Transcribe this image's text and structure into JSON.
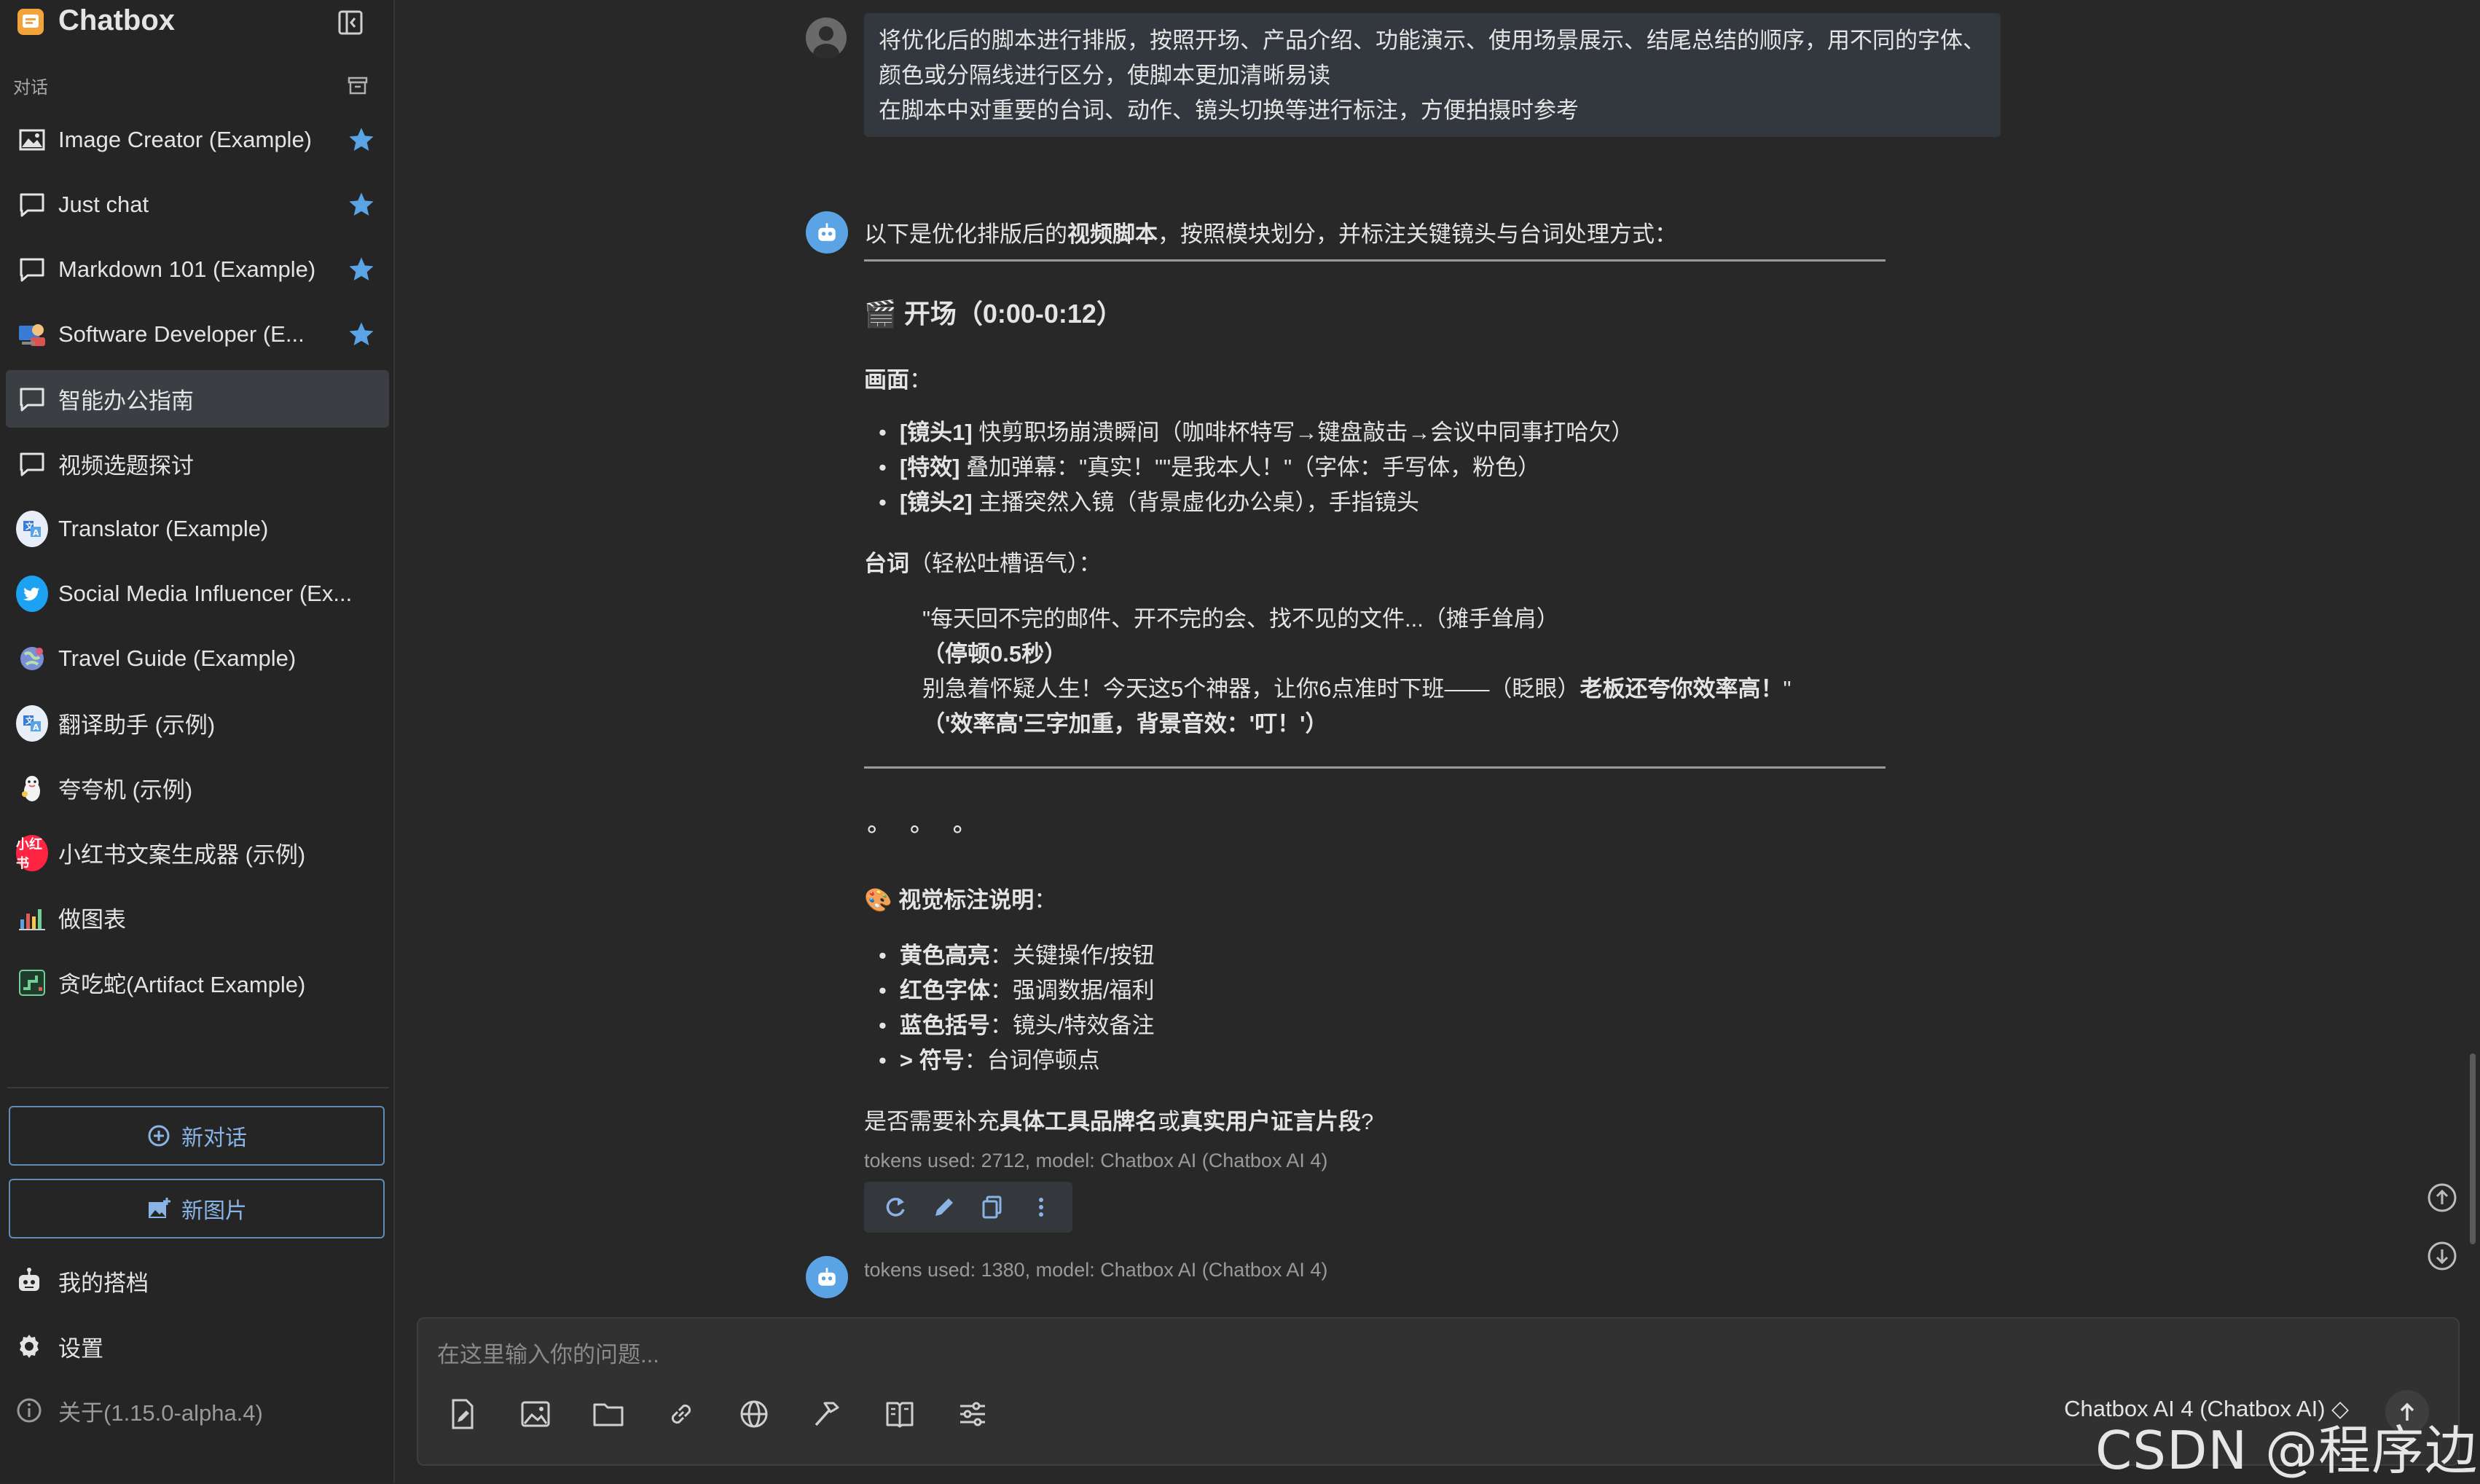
{
  "app": {
    "title": "Chatbox"
  },
  "sidebar": {
    "section_label": "对话",
    "items": [
      {
        "label": "Image Creator (Example)",
        "starred": true,
        "icon": "image-icon"
      },
      {
        "label": "Just chat",
        "starred": true,
        "icon": "chat-bubble-icon"
      },
      {
        "label": "Markdown 101 (Example)",
        "starred": true,
        "icon": "chat-bubble-icon"
      },
      {
        "label": "Software Developer (E...",
        "starred": true,
        "icon": "developer-avatar"
      },
      {
        "label": "智能办公指南",
        "starred": false,
        "active": true,
        "icon": "chat-bubble-icon"
      },
      {
        "label": "视频选题探讨",
        "starred": false,
        "icon": "chat-bubble-icon"
      },
      {
        "label": "Translator (Example)",
        "starred": false,
        "icon": "translator-avatar"
      },
      {
        "label": "Social Media Influencer (Ex...",
        "starred": false,
        "icon": "twitter-avatar"
      },
      {
        "label": "Travel Guide (Example)",
        "starred": false,
        "icon": "globe-avatar"
      },
      {
        "label": "翻译助手 (示例)",
        "starred": false,
        "icon": "translator-avatar"
      },
      {
        "label": "夸夸机 (示例)",
        "starred": false,
        "icon": "cheer-avatar"
      },
      {
        "label": "小红书文案生成器 (示例)",
        "starred": false,
        "icon": "xiaohongshu-avatar",
        "avatar_text": "小红书"
      },
      {
        "label": "做图表",
        "starred": false,
        "icon": "chart-avatar"
      },
      {
        "label": "贪吃蛇(Artifact Example)",
        "starred": false,
        "icon": "snake-avatar"
      }
    ],
    "new_chat": "新对话",
    "new_image": "新图片",
    "my_partners": "我的搭档",
    "settings": "设置",
    "about": "关于(1.15.0-alpha.4)"
  },
  "chat": {
    "user_message": [
      "将优化后的脚本进行排版，按照开场、产品介绍、功能演示、使用场景展示、结尾总结的顺序，用不同的字体、",
      "颜色或分隔线进行区分，使脚本更加清晰易读",
      "在脚本中对重要的台词、动作、镜头切换等进行标注，方便拍摄时参考"
    ],
    "reply": {
      "intro_pre": "以下是优化排版后的",
      "intro_bold": "视频脚本",
      "intro_post": "，按照模块划分，并标注关键镜头与台词处理方式：",
      "section_emoji": "🎬",
      "section_title": "开场（0:00-0:12）",
      "scene_label": "画面",
      "scene_colon": "：",
      "scene_bullets": [
        {
          "tag": "[镜头1]",
          "text": " 快剪职场崩溃瞬间（咖啡杯特写→键盘敲击→会议中同事打哈欠）"
        },
        {
          "tag": "[特效]",
          "text": " 叠加弹幕：\"真实！\"\"是我本人！\"（字体：手写体，粉色）"
        },
        {
          "tag": "[镜头2]",
          "text": " 主播突然入镜（背景虚化办公桌），手指镜头"
        }
      ],
      "lines_label": "台词",
      "lines_tone": "（轻松吐槽语气）：",
      "quote_1": "\"每天回不完的邮件、开不完的会、找不见的文件...（摊手耸肩）",
      "quote_2": "（停顿0.5秒）",
      "quote_3_pre": "别急着怀疑人生！今天这5个神器，让你6点准时下班——（眨眼）",
      "quote_3_bold": "老板还夸你效率高！",
      "quote_3_post": "\"",
      "quote_4": "（'效率高'三字加重，背景音效：'叮！'）",
      "ellipsis": "∘ ∘ ∘",
      "visual_emoji": "🎨",
      "visual_title": "视觉标注说明",
      "visual_colon": "：",
      "visual_bullets": [
        {
          "tag": "黄色高亮",
          "text": "：关键操作/按钮"
        },
        {
          "tag": "红色字体",
          "text": "：强调数据/福利"
        },
        {
          "tag": "蓝色括号",
          "text": "：镜头/特效备注"
        },
        {
          "tag": "> 符号",
          "text": "：台词停顿点"
        }
      ],
      "question_pre": "是否需要补充",
      "question_b1": "具体工具品牌名",
      "question_mid": "或",
      "question_b2": "真实用户证言片段",
      "question_post": "?",
      "meta": "tokens used: 2712, model: Chatbox AI (Chatbox AI 4)"
    },
    "second_meta": "tokens used: 1380, model: Chatbox AI (Chatbox AI 4)"
  },
  "input": {
    "placeholder": "在这里输入你的问题...",
    "model": "Chatbox AI 4 (Chatbox AI) ◇"
  },
  "watermark": "CSDN @程序边界",
  "colors": {
    "accent": "#5aa4e6",
    "star": "#5aa4e6",
    "button_border": "#5f8bb6"
  }
}
